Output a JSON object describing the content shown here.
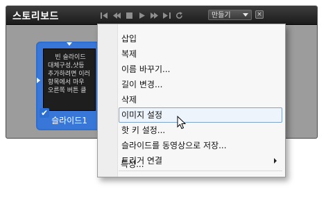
{
  "panel": {
    "title": "스토리보드",
    "controls": [
      {
        "icon": "skip-to-start-icon"
      },
      {
        "icon": "rewind-icon"
      },
      {
        "icon": "stop-icon"
      },
      {
        "icon": "play-icon"
      },
      {
        "icon": "fast-forward-icon"
      },
      {
        "icon": "skip-to-end-icon"
      },
      {
        "icon": "loop-icon"
      }
    ],
    "mode_select": {
      "value": "만들기"
    },
    "close_label": "×"
  },
  "slide": {
    "label": "슬라이드1",
    "thumb_lines": [
      "빈 슬라이드",
      "대체구성,샷등",
      "추가하려면 이러",
      "항목에서 마우",
      "오른쪽 버튼 클"
    ],
    "selected": true
  },
  "menu": {
    "items": [
      {
        "label": "삽입"
      },
      {
        "label": "복제"
      },
      {
        "label": "이름 바꾸기..."
      },
      {
        "label": "길이 변경..."
      },
      {
        "label": "삭제"
      },
      {
        "label": "이미지 설정",
        "highlighted": true
      },
      {
        "label": "핫 키 설정..."
      },
      {
        "label": "슬라이드를 동영상으로 저장..."
      },
      {
        "label": "트리거 연결",
        "submenu": true
      },
      {
        "label": "특성..."
      }
    ]
  },
  "colors": {
    "accent": "#2d6fd0",
    "titlebar": "#1b1b1b",
    "highlight_border": "#7da2ce"
  }
}
